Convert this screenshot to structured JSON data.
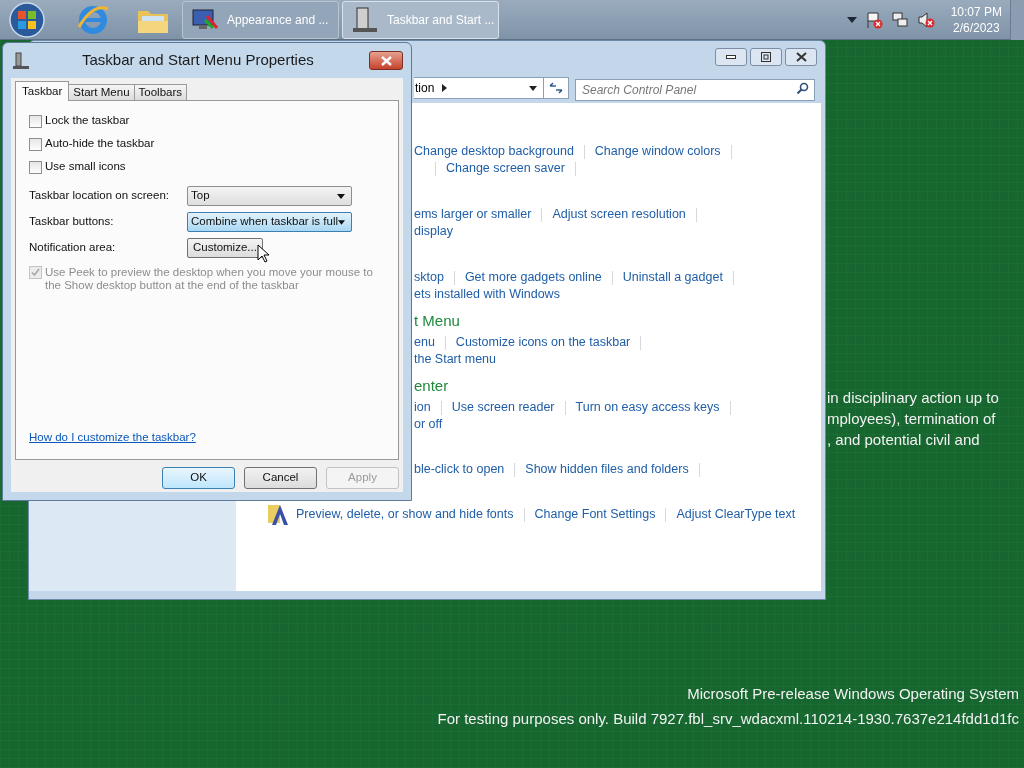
{
  "taskbar": {
    "tasks": [
      {
        "label": "Appearance and ...",
        "selected": false
      },
      {
        "label": "Taskbar and Start ...",
        "selected": true
      }
    ],
    "clock": {
      "time": "10:07 PM",
      "date": "2/6/2023"
    }
  },
  "control_panel": {
    "address": "tion",
    "search_placeholder": "Search Control Panel",
    "lines": [
      {
        "kind": "links",
        "lead_sep": false,
        "links": [
          "Change desktop background",
          "Change window colors"
        ]
      },
      {
        "kind": "links",
        "lead_sep": true,
        "links": [
          "Change screen saver"
        ]
      },
      {
        "kind": "links",
        "lead_sep": false,
        "links": [
          "ems larger or smaller",
          "Adjust screen resolution"
        ]
      },
      {
        "kind": "text",
        "lead_sep": false,
        "links": [
          "display"
        ]
      },
      {
        "kind": "links",
        "lead_sep": false,
        "links": [
          "sktop",
          "Get more gadgets online",
          "Uninstall a gadget"
        ]
      },
      {
        "kind": "text",
        "lead_sep": false,
        "links": [
          "ets installed with Windows"
        ]
      },
      {
        "kind": "heading",
        "lead_sep": false,
        "links": [
          "t Menu"
        ]
      },
      {
        "kind": "links",
        "lead_sep": false,
        "links": [
          "enu",
          "Customize icons on the taskbar"
        ]
      },
      {
        "kind": "text",
        "lead_sep": false,
        "links": [
          "the Start menu"
        ]
      },
      {
        "kind": "heading",
        "lead_sep": false,
        "links": [
          "enter"
        ]
      },
      {
        "kind": "links",
        "lead_sep": false,
        "links": [
          "ion",
          "Use screen reader",
          "Turn on easy access keys"
        ]
      },
      {
        "kind": "text",
        "lead_sep": false,
        "links": [
          "or off"
        ]
      },
      {
        "kind": "links",
        "lead_sep": false,
        "links": [
          "ble-click to open",
          "Show hidden files and folders"
        ]
      },
      {
        "kind": "fonts",
        "lead_sep": false,
        "links": [
          "Preview, delete, or show and hide fonts",
          "Change Font Settings",
          "Adjust ClearType text"
        ]
      }
    ]
  },
  "dialog": {
    "title": "Taskbar and Start Menu Properties",
    "tabs": [
      {
        "label": "Taskbar",
        "selected": true
      },
      {
        "label": "Start Menu",
        "selected": false
      },
      {
        "label": "Toolbars",
        "selected": false
      }
    ],
    "checkboxes": [
      {
        "label": "Lock the taskbar",
        "checked": false
      },
      {
        "label": "Auto-hide the taskbar",
        "checked": false
      },
      {
        "label": "Use small icons",
        "checked": false
      }
    ],
    "settings": [
      {
        "label": "Taskbar location on screen:",
        "kind": "select",
        "value": "Top",
        "focused": false
      },
      {
        "label": "Taskbar buttons:",
        "kind": "select",
        "value": "Combine when taskbar is full",
        "focused": true
      },
      {
        "label": "Notification area:",
        "kind": "button",
        "value": "Customize...",
        "focused": false
      }
    ],
    "peek": {
      "label": "Use Peek to preview the desktop when you move your mouse to the Show desktop button at the end of the taskbar",
      "checked": true,
      "disabled": true
    },
    "help_link": "How do I customize the taskbar?",
    "buttons": [
      {
        "label": "OK",
        "default": true,
        "disabled": false
      },
      {
        "label": "Cancel",
        "default": false,
        "disabled": false
      },
      {
        "label": "Apply",
        "default": false,
        "disabled": true
      }
    ]
  },
  "desktop": {
    "notice_lines": [
      "in disciplinary action up to",
      "mployees), termination of",
      ", and potential civil and"
    ],
    "build_lines": [
      "Microsoft Pre-release Windows Operating System",
      "For testing purposes only. Build 7927.fbl_srv_wdacxml.110214-1930.7637e214fdd1d1fc"
    ]
  }
}
